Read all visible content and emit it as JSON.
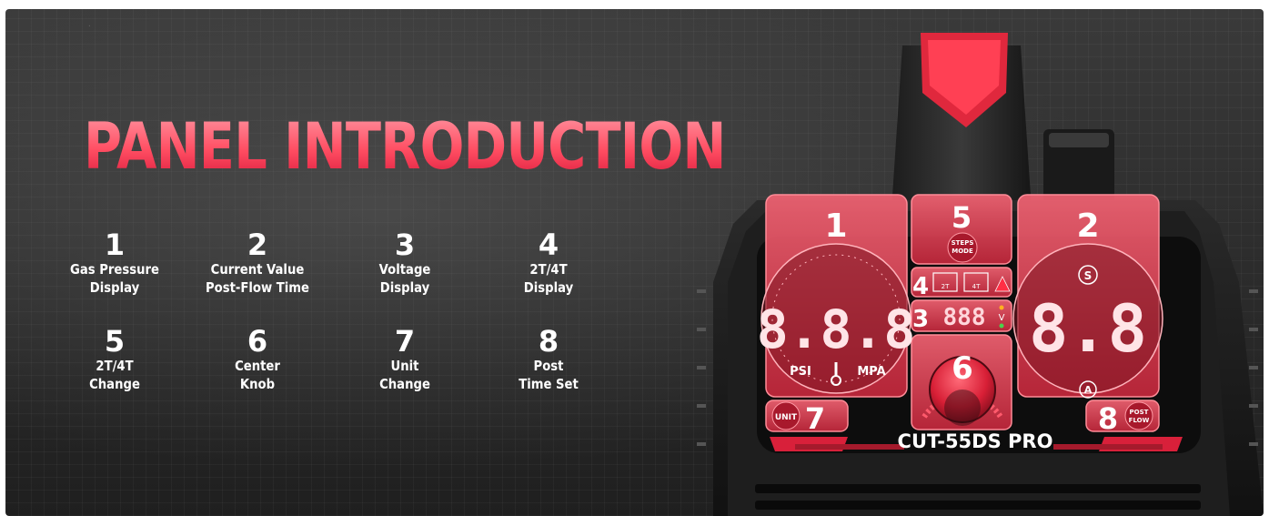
{
  "title": "PANEL INTRODUCTION",
  "legend": [
    {
      "num": "1",
      "line1": "Gas Pressure",
      "line2": "Display"
    },
    {
      "num": "2",
      "line1": "Current Value",
      "line2": "Post-Flow Time"
    },
    {
      "num": "3",
      "line1": "Voltage",
      "line2": "Display"
    },
    {
      "num": "4",
      "line1": "2T/4T",
      "line2": "Display"
    },
    {
      "num": "5",
      "line1": "2T/4T",
      "line2": "Change"
    },
    {
      "num": "6",
      "line1": "Center",
      "line2": "Knob"
    },
    {
      "num": "7",
      "line1": "Unit",
      "line2": "Change"
    },
    {
      "num": "8",
      "line1": "Post",
      "line2": "Time Set"
    }
  ],
  "panel": {
    "model": "CUT-55DS PRO",
    "left_readout": "8.8.8",
    "right_readout": "8.8",
    "volt_readout": "888",
    "psi_label": "PSI",
    "mpa_label": "MPA",
    "s_label": "S",
    "a_label": "A",
    "v_label": "V",
    "steps_line1": "STEPS",
    "steps_line2": "MODE",
    "unit_button": "UNIT",
    "post_line1": "POST",
    "post_line2": "FLOW",
    "mode_2t": "2T",
    "mode_4t": "4T",
    "callouts": {
      "c1": "1",
      "c2": "2",
      "c3": "3",
      "c4": "4",
      "c5": "5",
      "c6": "6",
      "c7": "7",
      "c8": "8"
    }
  },
  "colors": {
    "accent": "#ff3a52",
    "panel_glow": "#ff4a5e",
    "background": "#2e2e2e",
    "text": "#ffffff"
  }
}
